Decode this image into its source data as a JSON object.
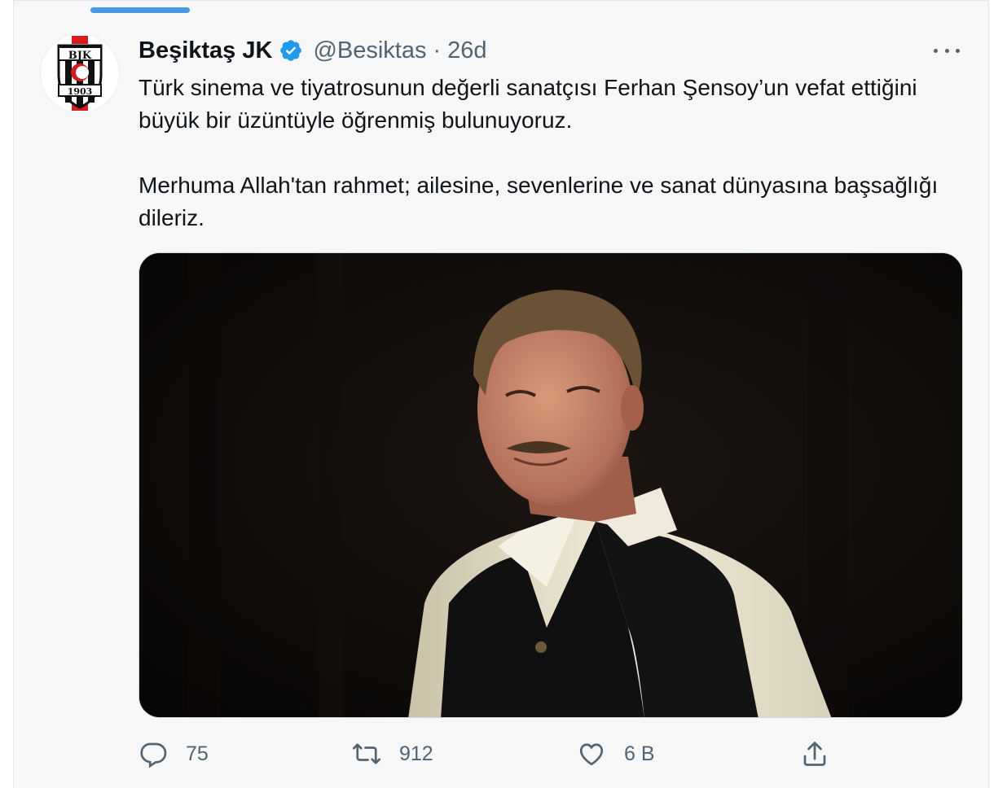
{
  "tweet": {
    "author_name": "Beşiktaş JK",
    "handle": "@Besiktas",
    "separator": "·",
    "time": "26d",
    "paragraph1": "Türk sinema ve tiyatrosunun değerli sanatçısı Ferhan Şensoy’un vefat ettiğini büyük bir üzüntüyle öğrenmiş bulunuyoruz.",
    "paragraph2": "Merhuma Allah'tan rahmet; ailesine, sevenlerine ve sanat dünyasına başsağlığı dileriz."
  },
  "avatar": {
    "logo_text": "BJK",
    "logo_year": "1903"
  },
  "actions": {
    "reply_count": "75",
    "retweet_count": "912",
    "like_count": "6 B"
  },
  "colors": {
    "accent": "#4a99e9",
    "verified": "#1d9bf0",
    "muted": "#536471",
    "text": "#0f1419"
  },
  "icons": [
    "verified-badge-icon",
    "more-icon",
    "reply-icon",
    "retweet-icon",
    "like-icon",
    "share-icon"
  ]
}
